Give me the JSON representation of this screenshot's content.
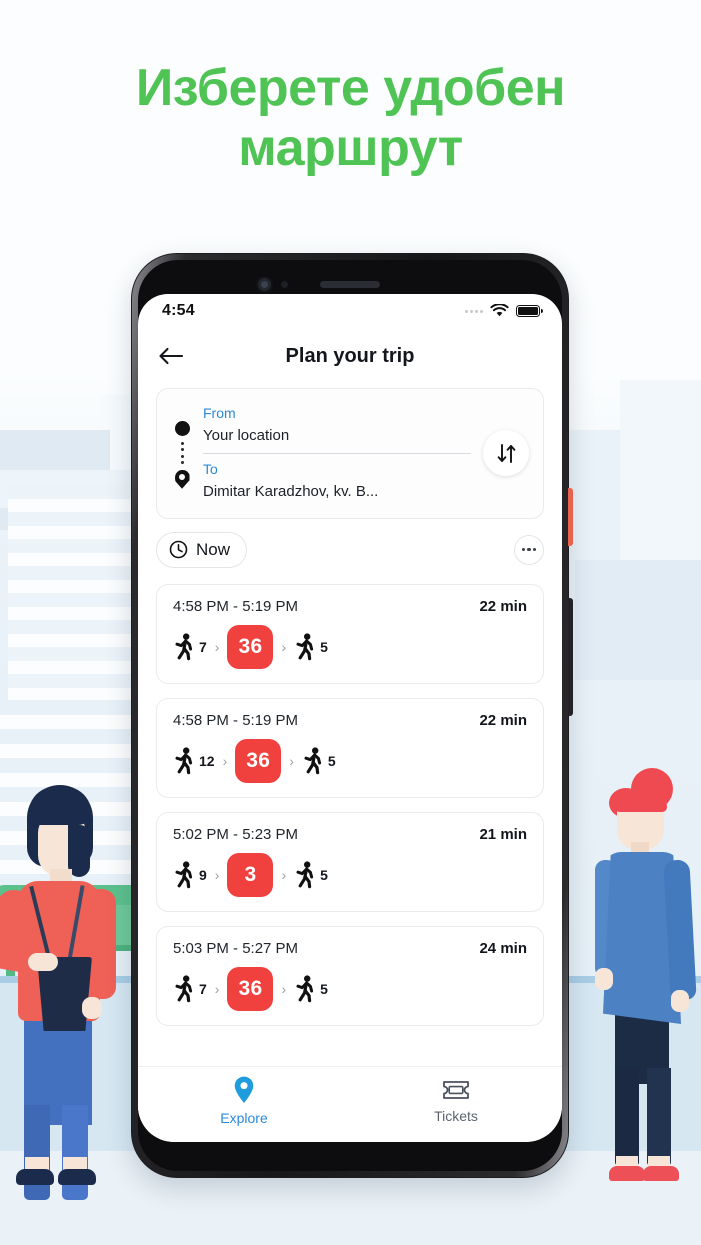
{
  "headline": {
    "line1": "Изберете удобен",
    "line2": "маршрут",
    "color": "#4fc455"
  },
  "phone": {
    "statusbar": {
      "time": "4:54",
      "wifi_icon": "wifi-icon",
      "battery_icon": "battery-full-icon",
      "signal_icon": "signal-dots-icon"
    },
    "appbar": {
      "back_icon": "back-arrow-icon",
      "title": "Plan your trip"
    },
    "trip_form": {
      "from_label": "From",
      "from_value": "Your location",
      "to_label": "To",
      "to_value": "Dimitar Karadzhov, kv. B...",
      "from_icon": "origin-dot-icon",
      "to_icon": "destination-pin-icon",
      "swap_icon": "swap-vertical-icon"
    },
    "filters": {
      "time_chip_label": "Now",
      "clock_icon": "clock-icon",
      "more_icon": "more-options-icon"
    },
    "routes": [
      {
        "time_range": "4:58 PM - 5:19 PM",
        "duration": "22 min",
        "legs": [
          {
            "type": "walk",
            "value": "7"
          },
          {
            "type": "chevron",
            "value": "›"
          },
          {
            "type": "line",
            "value": "36"
          },
          {
            "type": "chevron",
            "value": "›"
          },
          {
            "type": "walk",
            "value": "5"
          }
        ]
      },
      {
        "time_range": "4:58 PM - 5:19 PM",
        "duration": "22 min",
        "legs": [
          {
            "type": "walk",
            "value": "12"
          },
          {
            "type": "chevron",
            "value": "›"
          },
          {
            "type": "line",
            "value": "36"
          },
          {
            "type": "chevron",
            "value": "›"
          },
          {
            "type": "walk",
            "value": "5"
          }
        ]
      },
      {
        "time_range": "5:02 PM - 5:23 PM",
        "duration": "21 min",
        "legs": [
          {
            "type": "walk",
            "value": "9"
          },
          {
            "type": "chevron",
            "value": "›"
          },
          {
            "type": "line",
            "value": "3"
          },
          {
            "type": "chevron",
            "value": "›"
          },
          {
            "type": "walk",
            "value": "5"
          }
        ]
      },
      {
        "time_range": "5:03 PM - 5:27 PM",
        "duration": "24 min",
        "legs": [
          {
            "type": "walk",
            "value": "7"
          },
          {
            "type": "chevron",
            "value": "›"
          },
          {
            "type": "line",
            "value": "36"
          },
          {
            "type": "chevron",
            "value": "›"
          },
          {
            "type": "walk",
            "value": "5"
          }
        ]
      }
    ],
    "bottom_nav": [
      {
        "label": "Explore",
        "icon": "map-pin-icon",
        "active": true
      },
      {
        "label": "Tickets",
        "icon": "ticket-icon",
        "active": false
      }
    ]
  },
  "colors": {
    "accent_green": "#4fc455",
    "transit_red": "#f0413f",
    "link_blue": "#2b8ad8",
    "page_bg": "#eaf1f7"
  }
}
